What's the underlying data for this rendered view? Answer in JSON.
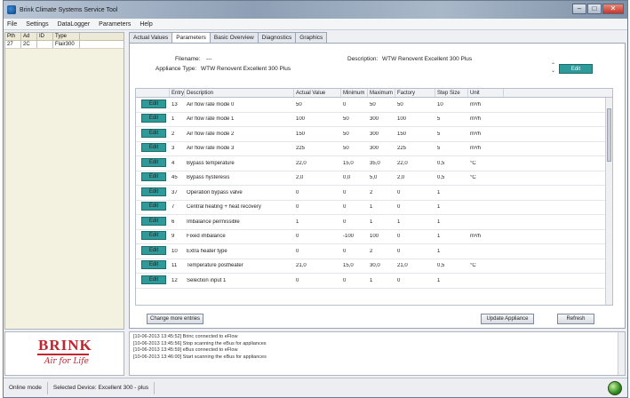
{
  "window": {
    "title": "Brink Climate Systems Service Tool"
  },
  "menu": [
    "File",
    "Settings",
    "DataLogger",
    "Parameters",
    "Help"
  ],
  "devices": {
    "columns": [
      "Pth",
      "Ad",
      "ID",
      "Type"
    ],
    "rows": [
      [
        "27",
        "2C",
        "",
        "Flair300"
      ]
    ]
  },
  "tabs": [
    "Actual Values",
    "Parameters",
    "Basic Overview",
    "Diagnostics",
    "Graphics"
  ],
  "active_tab": "Parameters",
  "header": {
    "filename_label": "Filename:",
    "filename_value": "---",
    "appliance_label": "Appliance Type:",
    "appliance_value": "WTW Renovent Excellent 300 Plus",
    "description_label": "Description:",
    "description_value": "WTW Renovent Excellent 300 Plus",
    "edit_label": "Edit"
  },
  "table": {
    "columns": [
      "",
      "Entry",
      "Description",
      "Actual Value",
      "Minimum",
      "Maximum",
      "Factory",
      "Step Size",
      "Unit"
    ],
    "rows": [
      {
        "btn": "Edit",
        "entry": "13",
        "desc": "Air flow rate mode 0",
        "act": "50",
        "min": "0",
        "max": "50",
        "fac": "50",
        "step": "10",
        "unit": "m³/h"
      },
      {
        "btn": "Edit",
        "entry": "1",
        "desc": "Air flow rate mode 1",
        "act": "100",
        "min": "50",
        "max": "300",
        "fac": "100",
        "step": "5",
        "unit": "m³/h"
      },
      {
        "btn": "Edit",
        "entry": "2",
        "desc": "Air flow rate mode 2",
        "act": "150",
        "min": "50",
        "max": "300",
        "fac": "150",
        "step": "5",
        "unit": "m³/h"
      },
      {
        "btn": "Edit",
        "entry": "3",
        "desc": "Air flow rate mode 3",
        "act": "225",
        "min": "50",
        "max": "300",
        "fac": "225",
        "step": "5",
        "unit": "m³/h"
      },
      {
        "btn": "Edit",
        "entry": "4",
        "desc": "Bypass temperature",
        "act": "22,0",
        "min": "15,0",
        "max": "35,0",
        "fac": "22,0",
        "step": "0,5",
        "unit": "°C"
      },
      {
        "btn": "Edit",
        "entry": "45",
        "desc": "Bypass hysteresis",
        "act": "2,0",
        "min": "0,0",
        "max": "5,0",
        "fac": "2,0",
        "step": "0,5",
        "unit": "°C"
      },
      {
        "btn": "Edit",
        "entry": "37",
        "desc": "Operation bypass valve",
        "act": "0",
        "min": "0",
        "max": "2",
        "fac": "0",
        "step": "1",
        "unit": ""
      },
      {
        "btn": "Edit",
        "entry": "7",
        "desc": "Central heating + heat recovery",
        "act": "0",
        "min": "0",
        "max": "1",
        "fac": "0",
        "step": "1",
        "unit": ""
      },
      {
        "btn": "Edit",
        "entry": "6",
        "desc": "Imbalance permissible",
        "act": "1",
        "min": "0",
        "max": "1",
        "fac": "1",
        "step": "1",
        "unit": ""
      },
      {
        "btn": "Edit",
        "entry": "9",
        "desc": "Fixed imbalance",
        "act": "0",
        "min": "-100",
        "max": "100",
        "fac": "0",
        "step": "1",
        "unit": "m³/h"
      },
      {
        "btn": "Edit",
        "entry": "10",
        "desc": "Extra heater type",
        "act": "0",
        "min": "0",
        "max": "2",
        "fac": "0",
        "step": "1",
        "unit": ""
      },
      {
        "btn": "Edit",
        "entry": "11",
        "desc": "Temperature postheater",
        "act": "21,0",
        "min": "15,0",
        "max": "30,0",
        "fac": "21,0",
        "step": "0,5",
        "unit": "°C"
      },
      {
        "btn": "Edit",
        "entry": "12",
        "desc": "Selection input 1",
        "act": "0",
        "min": "0",
        "max": "1",
        "fac": "0",
        "step": "1",
        "unit": ""
      }
    ]
  },
  "buttons": {
    "change_max": "Change more entries",
    "update": "Update Appliance",
    "refresh": "Refresh"
  },
  "logo": {
    "brand": "BRINK",
    "tagline": "Air for Life"
  },
  "log": [
    "[10-06-2013 13:45:52] Brinc connected to eFlow",
    "[10-06-2013 13:45:56] Stop scanning the eBus for appliances",
    "[10-06-2013 13:45:59] eBus connected to eFlow",
    "[10-06-2013 13:46:00] Start scanning the eBus for appliances"
  ],
  "status": {
    "mode": "Online mode",
    "device": "Selected Device: Excellent 300 - plus"
  }
}
